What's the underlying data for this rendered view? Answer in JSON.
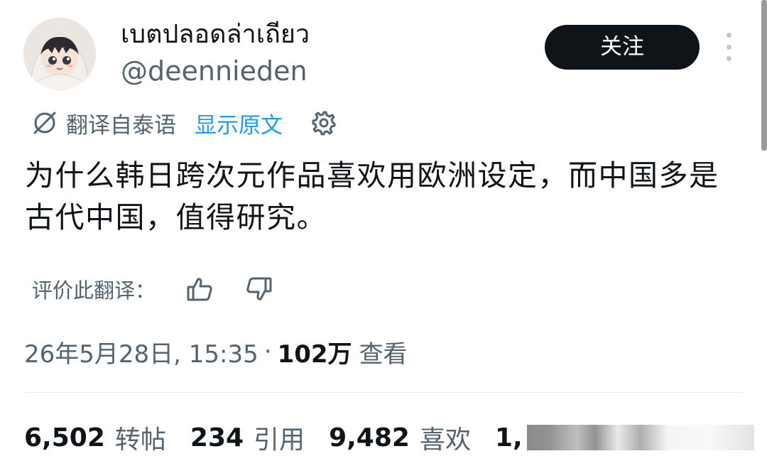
{
  "user": {
    "display_name": "เบตปลอดล่าเถียว",
    "handle": "@deennieden"
  },
  "actions": {
    "follow_label": "关注"
  },
  "translation": {
    "translated_from": "翻译自泰语",
    "show_original": "显示原文",
    "rate_label": "评价此翻译："
  },
  "tweet": {
    "text": "为什么韩日跨次元作品喜欢用欧洲设定，而中国多是古代中国，值得研究。"
  },
  "meta": {
    "timestamp": "26年5月28日, 15:35",
    "separator": "·",
    "views_count": "102万",
    "views_label": "查看"
  },
  "stats": [
    {
      "count": "6,502",
      "label": "转帖"
    },
    {
      "count": "234",
      "label": "引用"
    },
    {
      "count": "9,482",
      "label": "喜欢"
    },
    {
      "count": "1,",
      "label": ""
    }
  ],
  "colors": {
    "text_primary": "#0f1419",
    "text_secondary": "#536471",
    "link": "#1d9bf0",
    "button_bg": "#0f1419"
  },
  "icons": {
    "more": "more-vertical-icon",
    "translate": "no-translate-icon",
    "settings": "gear-icon",
    "like_translation": "thumb-up-icon",
    "dislike_translation": "thumb-down-icon"
  }
}
